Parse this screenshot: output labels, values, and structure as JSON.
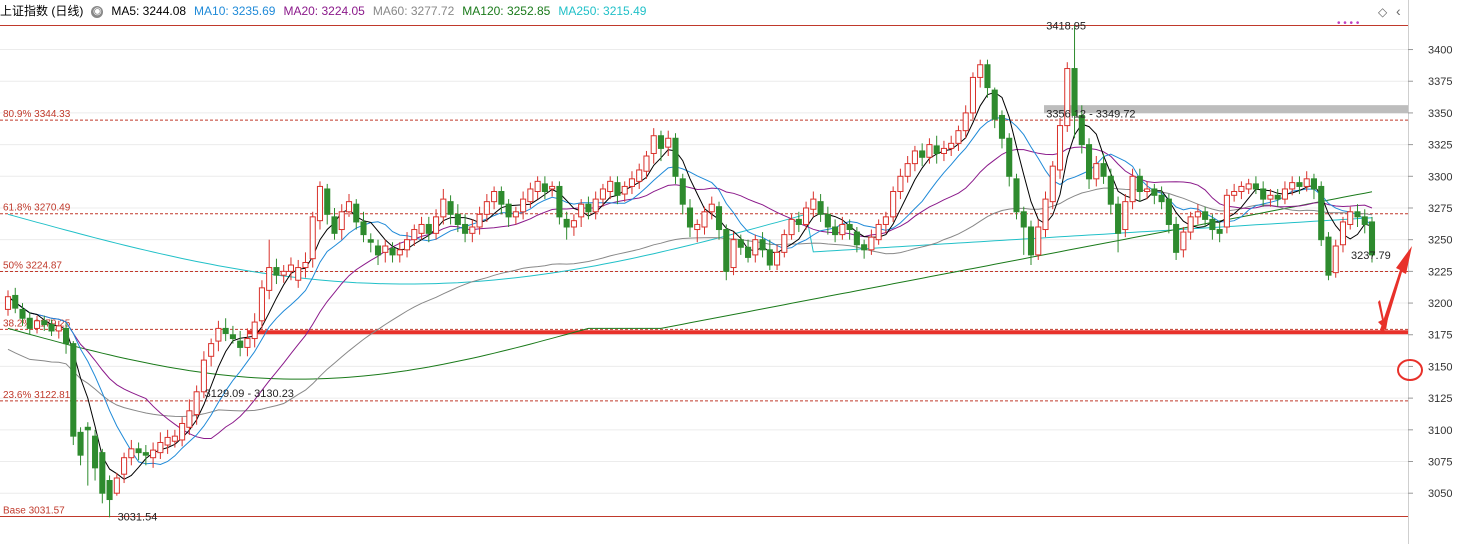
{
  "legend": {
    "title": "上证指数 (日线)",
    "items": [
      {
        "label": "MA5: 3244.08",
        "color": "#000000"
      },
      {
        "label": "MA10: 3235.69",
        "color": "#1f8ad8"
      },
      {
        "label": "MA20: 3224.05",
        "color": "#8b1a8b"
      },
      {
        "label": "MA60: 3277.72",
        "color": "#888888"
      },
      {
        "label": "MA120: 3252.85",
        "color": "#1a7a1a"
      },
      {
        "label": "MA250: 3215.49",
        "color": "#21c0c8"
      }
    ]
  },
  "colors": {
    "up": "#d9312b",
    "down": "#2e8b2e",
    "fib": "#c0392b",
    "support": "#e8312a",
    "resist_band": "#bdbdbd",
    "ma5": "#000000",
    "ma10": "#1f8ad8",
    "ma20": "#8b1a8b",
    "ma60": "#888888",
    "ma120": "#1a7a1a",
    "ma250": "#21c0c8"
  },
  "chart_data": {
    "type": "candlestick",
    "y_axis": {
      "range": [
        3020,
        3440
      ],
      "ticks": [
        3050,
        3075,
        3100,
        3125,
        3150,
        3175,
        3200,
        3225,
        3250,
        3275,
        3300,
        3325,
        3350,
        3375,
        3400
      ],
      "tick_labels": [
        "3050",
        "3075",
        "3100",
        "3125",
        "3150",
        "3175",
        "3200",
        "3225",
        "3250",
        "3275",
        "3300",
        "3325",
        "3350",
        "3375",
        "3400"
      ],
      "grid": true
    },
    "fib_levels": [
      {
        "label": "80.9% 3344.33",
        "value": 3344.33
      },
      {
        "label": "61.8% 3270.49",
        "value": 3270.49
      },
      {
        "label": "50% 3224.87",
        "value": 3224.87
      },
      {
        "label": "38.2% 3179.25",
        "value": 3179.25
      },
      {
        "label": "23.6% 3122.81",
        "value": 3122.81
      },
      {
        "label": "Base 3031.57",
        "value": 3031.57
      }
    ],
    "top_line": 3418.95,
    "support_line": 3177,
    "resistance_band": {
      "from": 3349.72,
      "to": 3356.12
    },
    "annotations": [
      {
        "text": "3418.95",
        "index": 142,
        "value": 3418.95
      },
      {
        "text": "3356.12 - 3349.72",
        "index": 142,
        "value": 3349.72
      },
      {
        "text": "3031.54",
        "index": 14,
        "value": 3031.54
      },
      {
        "text": "3129.09 - 3130.23",
        "index": 26,
        "value": 3129.09
      },
      {
        "text": "3237.79",
        "index": 184,
        "value": 3237.79
      }
    ],
    "candles": [
      [
        3195,
        3205,
        3190,
        3210
      ],
      [
        3206,
        3196,
        3192,
        3212
      ],
      [
        3195,
        3188,
        3182,
        3200
      ],
      [
        3188,
        3180,
        3175,
        3193
      ],
      [
        3180,
        3186,
        3176,
        3190
      ],
      [
        3186,
        3183,
        3178,
        3190
      ],
      [
        3183,
        3178,
        3174,
        3187
      ],
      [
        3178,
        3182,
        3172,
        3186
      ],
      [
        3180,
        3168,
        3160,
        3184
      ],
      [
        3168,
        3095,
        3088,
        3170
      ],
      [
        3098,
        3080,
        3072,
        3102
      ],
      [
        3102,
        3100,
        3056,
        3106
      ],
      [
        3095,
        3070,
        3060,
        3100
      ],
      [
        3082,
        3050,
        3042,
        3085
      ],
      [
        3060,
        3045,
        3031,
        3064
      ],
      [
        3050,
        3062,
        3048,
        3066
      ],
      [
        3065,
        3078,
        3058,
        3082
      ],
      [
        3078,
        3085,
        3072,
        3092
      ],
      [
        3085,
        3082,
        3076,
        3090
      ],
      [
        3082,
        3080,
        3072,
        3088
      ],
      [
        3078,
        3084,
        3070,
        3090
      ],
      [
        3082,
        3090,
        3077,
        3098
      ],
      [
        3088,
        3094,
        3081,
        3100
      ],
      [
        3091,
        3095,
        3086,
        3100
      ],
      [
        3092,
        3105,
        3087,
        3110
      ],
      [
        3102,
        3115,
        3096,
        3124
      ],
      [
        3112,
        3130,
        3104,
        3135
      ],
      [
        3130,
        3155,
        3125,
        3162
      ],
      [
        3158,
        3168,
        3150,
        3172
      ],
      [
        3170,
        3180,
        3162,
        3186
      ],
      [
        3180,
        3176,
        3170,
        3188
      ],
      [
        3175,
        3172,
        3168,
        3182
      ],
      [
        3170,
        3165,
        3158,
        3178
      ],
      [
        3165,
        3172,
        3158,
        3180
      ],
      [
        3172,
        3185,
        3165,
        3192
      ],
      [
        3186,
        3212,
        3180,
        3218
      ],
      [
        3210,
        3228,
        3203,
        3250
      ],
      [
        3228,
        3222,
        3215,
        3235
      ],
      [
        3222,
        3225,
        3216,
        3230
      ],
      [
        3225,
        3230,
        3218,
        3236
      ],
      [
        3218,
        3228,
        3212,
        3234
      ],
      [
        3228,
        3232,
        3220,
        3240
      ],
      [
        3235,
        3268,
        3228,
        3272
      ],
      [
        3265,
        3292,
        3258,
        3296
      ],
      [
        3290,
        3270,
        3262,
        3294
      ],
      [
        3268,
        3255,
        3250,
        3275
      ],
      [
        3258,
        3272,
        3250,
        3278
      ],
      [
        3272,
        3280,
        3268,
        3286
      ],
      [
        3278,
        3264,
        3258,
        3282
      ],
      [
        3264,
        3254,
        3248,
        3272
      ],
      [
        3250,
        3248,
        3240,
        3255
      ],
      [
        3245,
        3238,
        3230,
        3250
      ],
      [
        3240,
        3245,
        3232,
        3250
      ],
      [
        3243,
        3238,
        3232,
        3248
      ],
      [
        3238,
        3242,
        3232,
        3248
      ],
      [
        3242,
        3250,
        3236,
        3256
      ],
      [
        3250,
        3258,
        3245,
        3262
      ],
      [
        3255,
        3262,
        3250,
        3268
      ],
      [
        3262,
        3255,
        3248,
        3268
      ],
      [
        3255,
        3268,
        3250,
        3274
      ],
      [
        3268,
        3282,
        3262,
        3290
      ],
      [
        3280,
        3270,
        3262,
        3285
      ],
      [
        3270,
        3262,
        3256,
        3278
      ],
      [
        3262,
        3255,
        3248,
        3270
      ],
      [
        3255,
        3260,
        3248,
        3266
      ],
      [
        3260,
        3270,
        3254,
        3276
      ],
      [
        3270,
        3280,
        3264,
        3286
      ],
      [
        3280,
        3288,
        3274,
        3292
      ],
      [
        3288,
        3278,
        3270,
        3292
      ],
      [
        3278,
        3268,
        3260,
        3282
      ],
      [
        3268,
        3272,
        3262,
        3276
      ],
      [
        3272,
        3282,
        3266,
        3288
      ],
      [
        3280,
        3290,
        3275,
        3295
      ],
      [
        3288,
        3296,
        3282,
        3300
      ],
      [
        3294,
        3288,
        3282,
        3300
      ],
      [
        3290,
        3292,
        3284,
        3296
      ],
      [
        3292,
        3268,
        3262,
        3296
      ],
      [
        3266,
        3260,
        3250,
        3272
      ],
      [
        3260,
        3265,
        3253,
        3270
      ],
      [
        3268,
        3278,
        3260,
        3282
      ],
      [
        3278,
        3272,
        3266,
        3284
      ],
      [
        3272,
        3282,
        3266,
        3288
      ],
      [
        3282,
        3290,
        3276,
        3294
      ],
      [
        3288,
        3296,
        3282,
        3300
      ],
      [
        3295,
        3285,
        3278,
        3300
      ],
      [
        3286,
        3292,
        3280,
        3296
      ],
      [
        3292,
        3298,
        3286,
        3304
      ],
      [
        3296,
        3305,
        3290,
        3310
      ],
      [
        3304,
        3316,
        3298,
        3320
      ],
      [
        3318,
        3332,
        3310,
        3338
      ],
      [
        3332,
        3322,
        3312,
        3336
      ],
      [
        3323,
        3330,
        3316,
        3336
      ],
      [
        3330,
        3300,
        3294,
        3334
      ],
      [
        3298,
        3278,
        3270,
        3302
      ],
      [
        3275,
        3260,
        3252,
        3282
      ],
      [
        3258,
        3262,
        3248,
        3266
      ],
      [
        3260,
        3272,
        3254,
        3276
      ],
      [
        3272,
        3278,
        3266,
        3284
      ],
      [
        3276,
        3258,
        3250,
        3280
      ],
      [
        3258,
        3225,
        3218,
        3262
      ],
      [
        3228,
        3250,
        3222,
        3256
      ],
      [
        3250,
        3244,
        3238,
        3254
      ],
      [
        3244,
        3236,
        3232,
        3250
      ],
      [
        3238,
        3250,
        3232,
        3254
      ],
      [
        3250,
        3242,
        3236,
        3256
      ],
      [
        3242,
        3230,
        3226,
        3250
      ],
      [
        3230,
        3240,
        3226,
        3246
      ],
      [
        3240,
        3254,
        3236,
        3258
      ],
      [
        3254,
        3266,
        3250,
        3270
      ],
      [
        3266,
        3262,
        3256,
        3272
      ],
      [
        3262,
        3275,
        3258,
        3280
      ],
      [
        3274,
        3282,
        3268,
        3288
      ],
      [
        3280,
        3270,
        3264,
        3286
      ],
      [
        3270,
        3260,
        3254,
        3276
      ],
      [
        3260,
        3254,
        3248,
        3266
      ],
      [
        3254,
        3262,
        3250,
        3268
      ],
      [
        3262,
        3258,
        3250,
        3266
      ],
      [
        3256,
        3246,
        3240,
        3260
      ],
      [
        3246,
        3242,
        3235,
        3250
      ],
      [
        3242,
        3252,
        3238,
        3258
      ],
      [
        3250,
        3262,
        3246,
        3266
      ],
      [
        3262,
        3268,
        3255,
        3272
      ],
      [
        3268,
        3288,
        3264,
        3292
      ],
      [
        3288,
        3300,
        3282,
        3306
      ],
      [
        3300,
        3310,
        3295,
        3316
      ],
      [
        3310,
        3320,
        3304,
        3324
      ],
      [
        3320,
        3315,
        3308,
        3326
      ],
      [
        3315,
        3325,
        3310,
        3330
      ],
      [
        3324,
        3318,
        3310,
        3332
      ],
      [
        3318,
        3322,
        3312,
        3328
      ],
      [
        3322,
        3326,
        3316,
        3332
      ],
      [
        3326,
        3336,
        3320,
        3340
      ],
      [
        3336,
        3350,
        3330,
        3356
      ],
      [
        3350,
        3378,
        3345,
        3382
      ],
      [
        3378,
        3388,
        3370,
        3392
      ],
      [
        3388,
        3370,
        3362,
        3392
      ],
      [
        3368,
        3345,
        3338,
        3370
      ],
      [
        3348,
        3330,
        3322,
        3352
      ],
      [
        3330,
        3300,
        3292,
        3334
      ],
      [
        3298,
        3272,
        3266,
        3302
      ],
      [
        3272,
        3260,
        3238,
        3276
      ],
      [
        3260,
        3238,
        3230,
        3265
      ],
      [
        3238,
        3260,
        3234,
        3266
      ],
      [
        3258,
        3282,
        3252,
        3288
      ],
      [
        3280,
        3308,
        3274,
        3312
      ],
      [
        3305,
        3340,
        3298,
        3346
      ],
      [
        3340,
        3385,
        3335,
        3390
      ],
      [
        3385,
        3348,
        3330,
        3418.95
      ],
      [
        3348,
        3325,
        3318,
        3356
      ],
      [
        3325,
        3298,
        3290,
        3330
      ],
      [
        3298,
        3310,
        3292,
        3316
      ],
      [
        3310,
        3300,
        3294,
        3318
      ],
      [
        3300,
        3278,
        3270,
        3306
      ],
      [
        3278,
        3255,
        3240,
        3284
      ],
      [
        3258,
        3280,
        3252,
        3286
      ],
      [
        3280,
        3300,
        3274,
        3306
      ],
      [
        3300,
        3288,
        3280,
        3306
      ],
      [
        3288,
        3290,
        3282,
        3296
      ],
      [
        3290,
        3285,
        3278,
        3294
      ],
      [
        3285,
        3280,
        3274,
        3292
      ],
      [
        3282,
        3262,
        3255,
        3286
      ],
      [
        3262,
        3240,
        3234,
        3268
      ],
      [
        3242,
        3256,
        3236,
        3260
      ],
      [
        3256,
        3268,
        3250,
        3272
      ],
      [
        3268,
        3272,
        3262,
        3278
      ],
      [
        3272,
        3266,
        3260,
        3276
      ],
      [
        3266,
        3258,
        3250,
        3270
      ],
      [
        3258,
        3255,
        3248,
        3264
      ],
      [
        3260,
        3285,
        3255,
        3290
      ],
      [
        3285,
        3288,
        3280,
        3294
      ],
      [
        3288,
        3292,
        3282,
        3296
      ],
      [
        3290,
        3294,
        3286,
        3298
      ],
      [
        3294,
        3290,
        3286,
        3300
      ],
      [
        3290,
        3282,
        3276,
        3296
      ],
      [
        3282,
        3285,
        3276,
        3290
      ],
      [
        3285,
        3282,
        3276,
        3290
      ],
      [
        3282,
        3290,
        3278,
        3296
      ],
      [
        3290,
        3295,
        3285,
        3300
      ],
      [
        3295,
        3292,
        3286,
        3300
      ],
      [
        3292,
        3298,
        3288,
        3304
      ],
      [
        3298,
        3290,
        3282,
        3302
      ],
      [
        3292,
        3250,
        3245,
        3296
      ],
      [
        3252,
        3222,
        3218,
        3256
      ],
      [
        3224,
        3245,
        3220,
        3250
      ],
      [
        3246,
        3264,
        3240,
        3268
      ],
      [
        3262,
        3272,
        3258,
        3276
      ],
      [
        3272,
        3268,
        3260,
        3278
      ],
      [
        3268,
        3262,
        3255,
        3274
      ],
      [
        3264,
        3238,
        3232,
        3268
      ]
    ]
  }
}
